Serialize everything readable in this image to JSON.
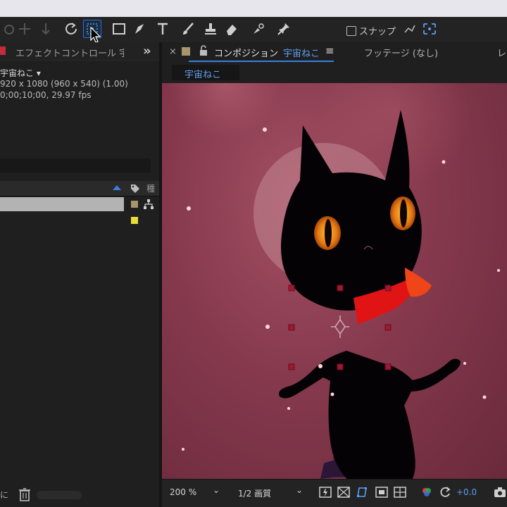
{
  "toolbar": {
    "snap_label": "スナップ"
  },
  "left_panel": {
    "title": "エフェクトコントロール 宇宙ねこ",
    "comp_name": "宇宙ねこ ▾",
    "info_size": "920 x 1080  (960 x 540) (1.00)",
    "info_duration": "0;00;10;00, 29.97 fps",
    "column_more": "種",
    "bottom_edge_text": "に",
    "label_colors": [
      "#a8956b",
      "#e8dc3a"
    ]
  },
  "composition": {
    "tab_label": "コンポジション",
    "tab_name": "宇宙ねこ",
    "footage_tab": "フッテージ (なし)",
    "edge_tab": "レ",
    "breadcrumb": "宇宙ねこ"
  },
  "viewer_footer": {
    "zoom": "200 %",
    "quality": "1/2 画質",
    "exposure": "+0.0"
  },
  "colors": {
    "accent": "#3a80e0",
    "selection_red": "#c72a3a",
    "background": "#1d1d1d"
  }
}
